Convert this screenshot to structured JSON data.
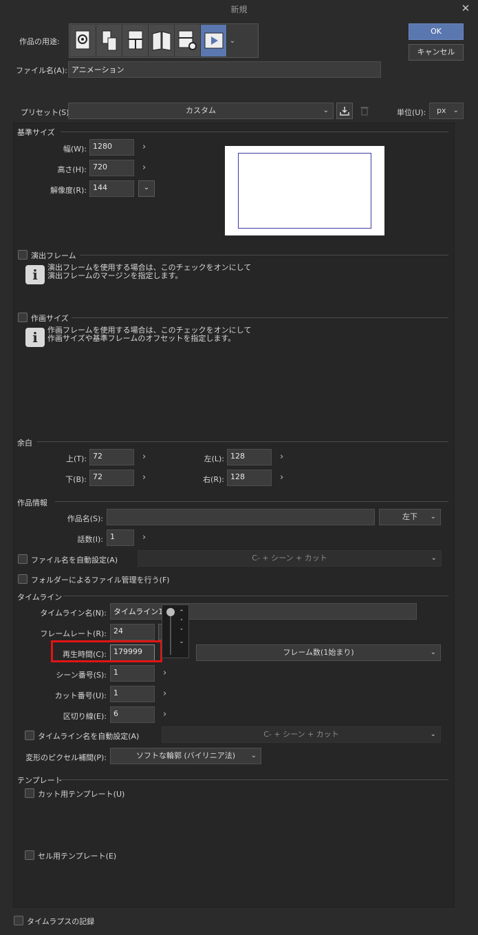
{
  "window": {
    "title": "新規"
  },
  "usage": {
    "label": "作品の用途:",
    "icons": [
      "illustration-icon",
      "webtoon-icon",
      "comic-icon",
      "print-comic-icon",
      "custom-icon",
      "animation-icon"
    ]
  },
  "buttons": {
    "ok": "OK",
    "cancel": "キャンセル"
  },
  "file_name": {
    "label": "ファイル名(A):",
    "value": "アニメーション"
  },
  "preset": {
    "label": "プリセット(S):",
    "value": "カスタム"
  },
  "unit": {
    "label": "単位(U):",
    "value": "px"
  },
  "base_size": {
    "heading": "基準サイズ",
    "width_label": "幅(W):",
    "width": "1280",
    "height_label": "高さ(H):",
    "height": "720",
    "resolution_label": "解像度(R):",
    "resolution": "144"
  },
  "direction_frame": {
    "label": "演出フレーム",
    "info_line1": "演出フレームを使用する場合は、このチェックをオンにして",
    "info_line2": "演出フレームのマージンを指定します。"
  },
  "drawing_size": {
    "label": "作画サイズ",
    "info_line1": "作画フレームを使用する場合は、このチェックをオンにして",
    "info_line2": "作画サイズや基準フレームのオフセットを指定します。"
  },
  "margin": {
    "heading": "余白",
    "top_label": "上(T):",
    "top": "72",
    "bottom_label": "下(B):",
    "bottom": "72",
    "left_label": "左(L):",
    "left": "128",
    "right_label": "右(R):",
    "right": "128"
  },
  "work_info": {
    "heading": "作品情報",
    "title_label": "作品名(S):",
    "title_value": "",
    "position": "左下",
    "episode_label": "話数(I):",
    "episode": "1",
    "auto_filename_label": "ファイル名を自動設定(A)",
    "auto_filename_value": "C- + シーン + カット",
    "folder_label": "フォルダーによるファイル管理を行う(F)"
  },
  "timeline": {
    "heading": "タイムライン",
    "name_label": "タイムライン名(N):",
    "name": "タイムライン1",
    "framerate_label": "フレームレート(R):",
    "framerate": "24",
    "duration_label": "再生時間(C):",
    "duration": "179999",
    "duration_unit": "フレーム数(1始まり)",
    "scene_label": "シーン番号(S):",
    "scene": "1",
    "cut_label": "カット番号(U):",
    "cut": "1",
    "divider_label": "区切り線(E):",
    "divider": "6",
    "auto_name_label": "タイムライン名を自動設定(A)",
    "auto_name_value": "C- + シーン + カット",
    "interp_label": "変形のピクセル補間(P):",
    "interp_value": "ソフトな輪郭 (バイリニア法)"
  },
  "template": {
    "heading": "テンプレート",
    "cut_label": "カット用テンプレート(U)",
    "cel_label": "セル用テンプレート(E)"
  },
  "timelapse": {
    "label": "タイムラプスの記録"
  },
  "colors": {
    "accent": "#5b77b0",
    "highlight": "#e31414"
  }
}
